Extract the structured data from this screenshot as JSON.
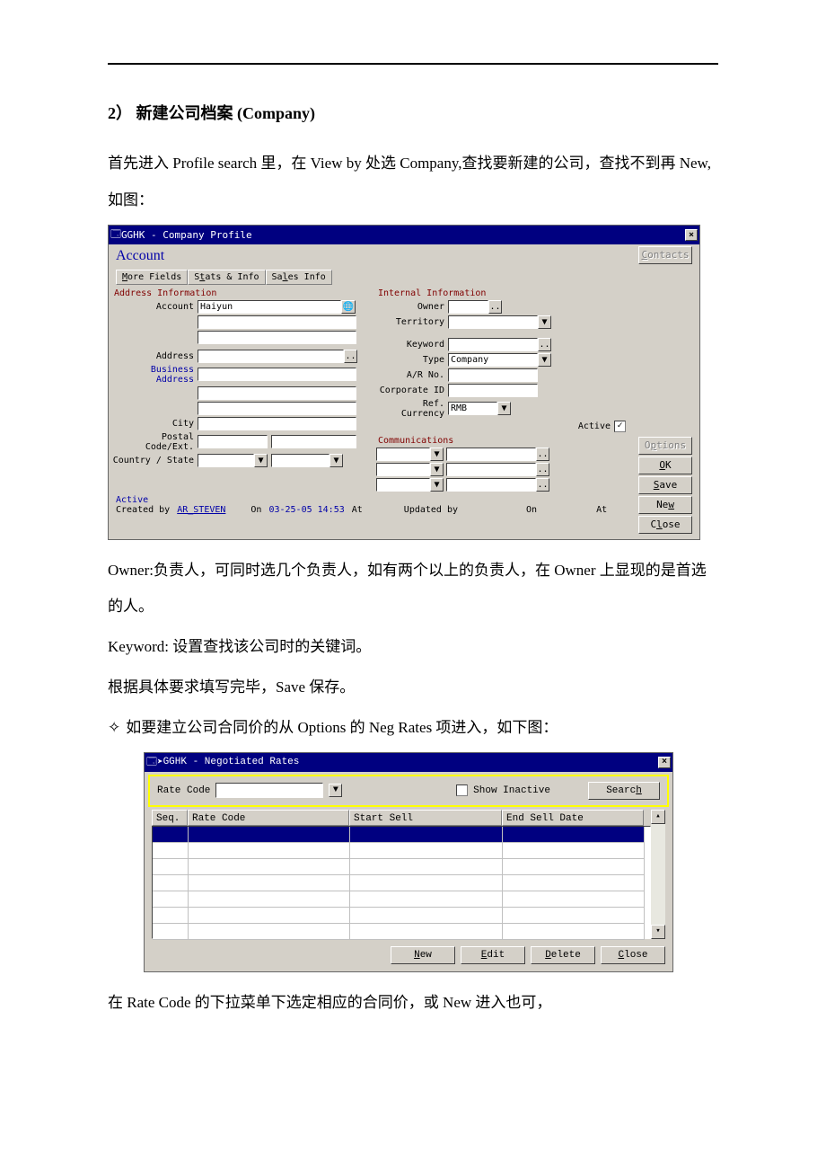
{
  "doc": {
    "heading": "2） 新建公司档案   (Company)",
    "para1": "首先进入 Profile search 里，在 View by 处选 Company,查找要新建的公司，查找不到再 New,如图：",
    "para2": "Owner:负责人，可同时选几个负责人，如有两个以上的负责人，在 Owner 上显现的是首选的人。",
    "para3": "Keyword:  设置查找该公司时的关键词。",
    "para4": "根据具体要求填写完毕，Save 保存。",
    "para5": "如要建立公司合同价的从 Options 的 Neg Rates 项进入，如下图：",
    "para6": "在 Rate Code 的下拉菜单下选定相应的合同价，或 New  进入也可，",
    "diamond": "✧"
  },
  "ss1": {
    "title": "GGHK - Company Profile",
    "account": "Account",
    "tabs": {
      "more": "More Fields",
      "stats": "Stats & Info",
      "sales": "Sales Info"
    },
    "addr_title": "Address Information",
    "int_title": "Internal Information",
    "labels": {
      "account": "Account",
      "address": "Address",
      "business_address": "Business Address",
      "city": "City",
      "postal": "Postal Code/Ext.",
      "country": "Country / State",
      "owner": "Owner",
      "territory": "Territory",
      "keyword": "Keyword",
      "type": "Type",
      "ar": "A/R No.",
      "corp": "Corporate ID",
      "refcur": "Ref. Currency",
      "active": "Active",
      "comm": "Communications"
    },
    "values": {
      "account": "Haiyun",
      "type": "Company",
      "refcur": "RMB"
    },
    "right": {
      "contacts": "Contacts",
      "options": "Options",
      "ok": "OK",
      "save": "Save",
      "new": "New",
      "close": "Close"
    },
    "footer": {
      "status": "Active",
      "created_by": "Created by",
      "user": "AR_STEVEN",
      "on1": "On",
      "date1": "03-25-05 14:53",
      "at1": "At",
      "updated_by": "Updated by",
      "on2": "On",
      "at2": "At"
    }
  },
  "ss2": {
    "title": "GGHK - Negotiated Rates",
    "rate_code_label": "Rate Code",
    "show_inactive": "Show Inactive",
    "search": "Search",
    "cols": {
      "seq": "Seq.",
      "rc": "Rate Code",
      "ss": "Start Sell",
      "es": "End Sell Date"
    },
    "buttons": {
      "new": "New",
      "edit": "Edit",
      "delete": "Delete",
      "close": "Close"
    }
  }
}
